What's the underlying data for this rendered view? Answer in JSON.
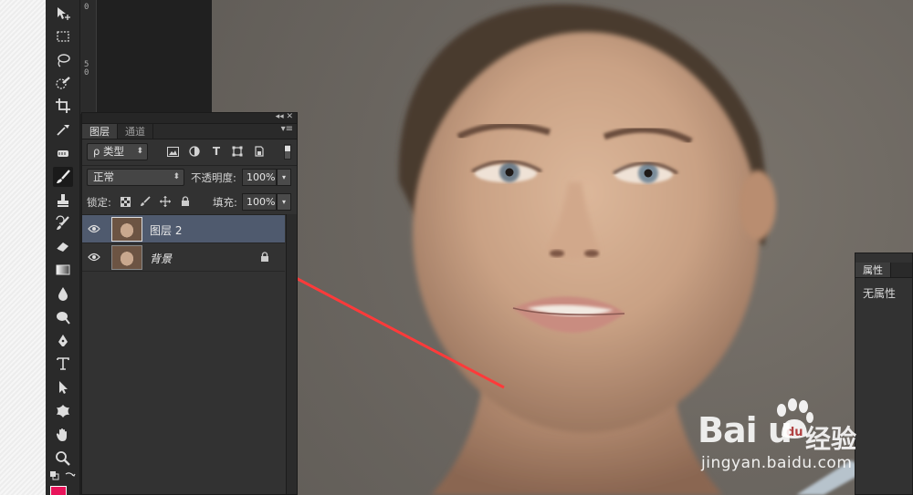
{
  "ruler": {
    "marks": [
      "0",
      "5",
      "0"
    ]
  },
  "tools": [
    {
      "name": "move-tool-icon",
      "glyph": "move"
    },
    {
      "name": "marquee-tool-icon",
      "glyph": "marquee"
    },
    {
      "name": "lasso-tool-icon",
      "glyph": "lasso"
    },
    {
      "name": "quick-select-tool-icon",
      "glyph": "quick"
    },
    {
      "name": "crop-tool-icon",
      "glyph": "crop"
    },
    {
      "name": "eyedropper-tool-icon",
      "glyph": "eyedropper"
    },
    {
      "name": "healing-brush-tool-icon",
      "glyph": "heal"
    },
    {
      "name": "brush-tool-icon",
      "glyph": "brush"
    },
    {
      "name": "stamp-tool-icon",
      "glyph": "stamp"
    },
    {
      "name": "history-brush-tool-icon",
      "glyph": "history"
    },
    {
      "name": "eraser-tool-icon",
      "glyph": "eraser"
    },
    {
      "name": "gradient-tool-icon",
      "glyph": "gradient"
    },
    {
      "name": "blur-tool-icon",
      "glyph": "blur"
    },
    {
      "name": "dodge-tool-icon",
      "glyph": "dodge"
    },
    {
      "name": "pen-tool-icon",
      "glyph": "pen"
    },
    {
      "name": "type-tool-icon",
      "glyph": "type"
    },
    {
      "name": "path-select-tool-icon",
      "glyph": "pathsel"
    },
    {
      "name": "shape-tool-icon",
      "glyph": "shape"
    },
    {
      "name": "hand-tool-icon",
      "glyph": "hand"
    },
    {
      "name": "zoom-tool-icon",
      "glyph": "zoom"
    }
  ],
  "colors": {
    "foreground": "#e8145a",
    "accent": "#4f5a6e",
    "panel": "#323232"
  },
  "layers_panel": {
    "header_controls": "◂◂  ✕",
    "tabs": [
      {
        "label": "图层",
        "active": true
      },
      {
        "label": "通道",
        "active": false
      }
    ],
    "menu_icon": "▾≡",
    "filter": {
      "label": "ρ 类型",
      "arrow": "⬍"
    },
    "blend_mode": {
      "value": "正常",
      "arrow": "⬍"
    },
    "opacity": {
      "label": "不透明度:",
      "value": "100%"
    },
    "lock": {
      "label": "锁定:"
    },
    "fill": {
      "label": "填充:",
      "value": "100%"
    },
    "layers": [
      {
        "name": "图层 2",
        "selected": true,
        "visible": true,
        "locked": false
      },
      {
        "name": "背景",
        "selected": false,
        "visible": true,
        "locked": true
      }
    ]
  },
  "properties_panel": {
    "tab": "属性",
    "content": "无属性"
  },
  "watermark": {
    "logo": "Bai  u",
    "brand_cn": "经验",
    "url": "jingyan.baidu.com"
  }
}
